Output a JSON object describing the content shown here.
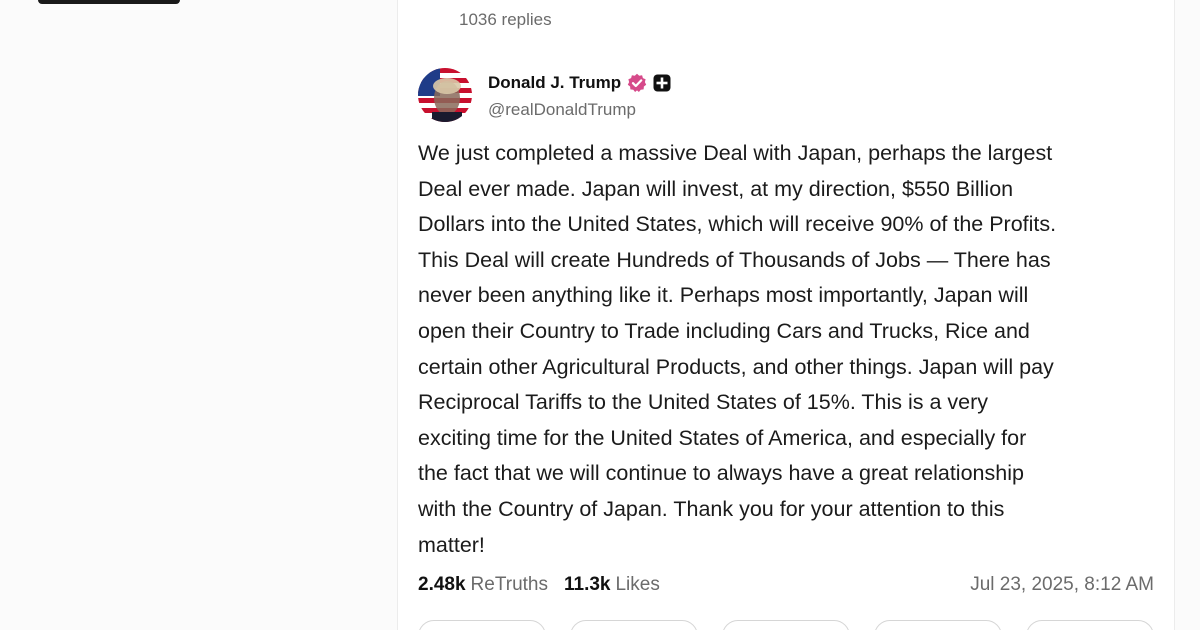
{
  "thread": {
    "replies_label": "1036 replies"
  },
  "post": {
    "author": {
      "display_name": "Donald J. Trump",
      "handle": "@realDonaldTrump",
      "verified_color": "#d64a8a"
    },
    "body": "We just completed a massive Deal with Japan, perhaps the largest\nDeal ever made. Japan will invest, at my direction, $550 Billion\nDollars into the United States, which will receive 90% of the Profits.\nThis Deal will create Hundreds of Thousands of Jobs — There has\nnever been anything like it. Perhaps most importantly, Japan will\nopen their Country to Trade including Cars and Trucks, Rice and\ncertain other Agricultural Products, and other things. Japan will pay\nReciprocal Tariffs to the United States of 15%. This is a very\nexciting time for the United States of America, and especially for\nthe fact that we will continue to always have a great relationship\nwith the Country of Japan. Thank you for your attention to this\nmatter!",
    "stats": {
      "retruths_count": "2.48k",
      "retruths_label": "ReTruths",
      "likes_count": "11.3k",
      "likes_label": "Likes"
    },
    "timestamp": "Jul 23, 2025, 8:12 AM"
  }
}
